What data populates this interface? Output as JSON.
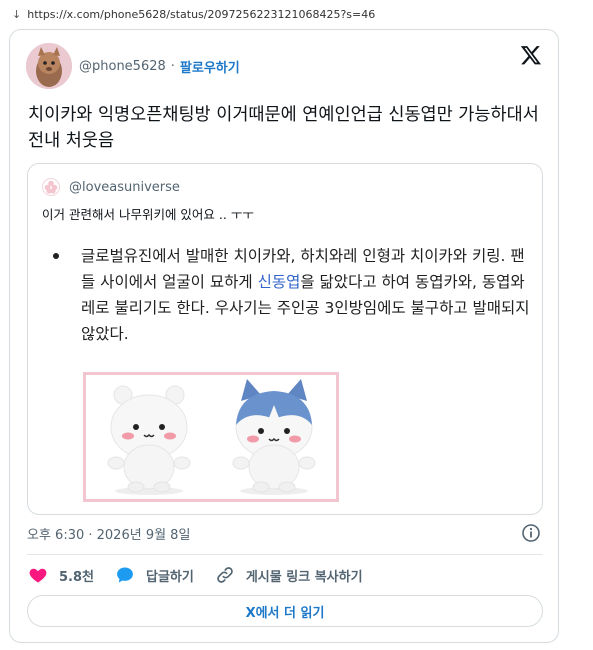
{
  "browser": {
    "url": "https://x.com/phone5628/status/2097256223121068425?s=46"
  },
  "tweet": {
    "author_handle": "@phone5628",
    "follow_label": "팔로우하기",
    "text": "치이카와 익명오픈채팅방 이거때문에 연예인언급 신동엽만 가능하대서 전내 처웃음",
    "timestamp": "오후 6:30 · 2026년 9월 8일",
    "likes": "5.8천",
    "reply_label": "답글하기",
    "copy_link_label": "게시물 링크 복사하기",
    "read_more_label": "X에서 더 읽기"
  },
  "quote": {
    "author_handle": "@loveasuniverse",
    "text": "이거 관련해서 나무위키에 있어요 .. ㅜㅜ",
    "bullet_before": "글로벌유진에서 발매한 치이카와, 하치와레 인형과 치이카와 키링. 팬들 사이에서 얼굴이 묘하게 ",
    "bullet_link": "신동엽",
    "bullet_after": "을 닮았다고 하여 동엽카와, 동엽와레로 불리기도 한다. 우사기는 주인공 3인방임에도 불구하고 발매되지 않았다."
  },
  "icons": {
    "x_logo": "x-logo-icon",
    "info": "info-icon",
    "like": "heart-icon",
    "reply": "speech-bubble-icon",
    "link": "link-icon"
  },
  "colors": {
    "accent": "#1d78c8",
    "like": "#f91880",
    "reply": "#1d9bf0",
    "link": "#3366cc"
  }
}
